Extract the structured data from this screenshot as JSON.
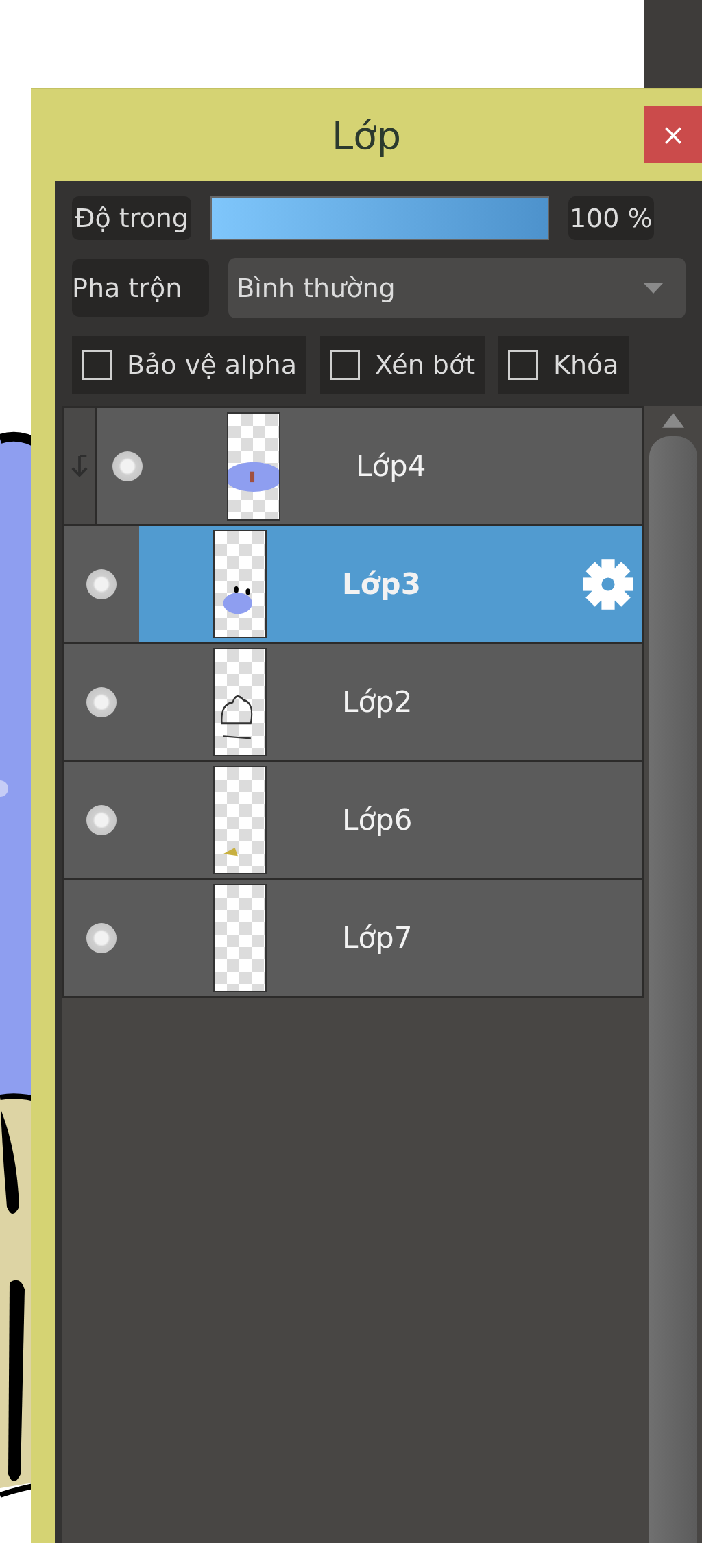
{
  "window": {
    "title": "Lớp",
    "close": "×"
  },
  "opacity": {
    "label": "Độ trong",
    "level": 1.0,
    "reading": "100 %"
  },
  "blend": {
    "label": "Pha trộn",
    "value": "Bình thường"
  },
  "options": [
    {
      "label": "Bảo vệ alpha",
      "checked": false
    },
    {
      "label": "Xén bớt",
      "checked": false
    },
    {
      "label": "Khóa",
      "checked": false
    }
  ],
  "layers": [
    {
      "name": "Lớp4",
      "selected": false,
      "clipped": true
    },
    {
      "name": "Lớp3",
      "selected": true,
      "clipped": false
    },
    {
      "name": "Lớp2",
      "selected": false,
      "clipped": false
    },
    {
      "name": "Lớp6",
      "selected": false,
      "clipped": false
    },
    {
      "name": "Lớp7",
      "selected": false,
      "clipped": false
    }
  ]
}
